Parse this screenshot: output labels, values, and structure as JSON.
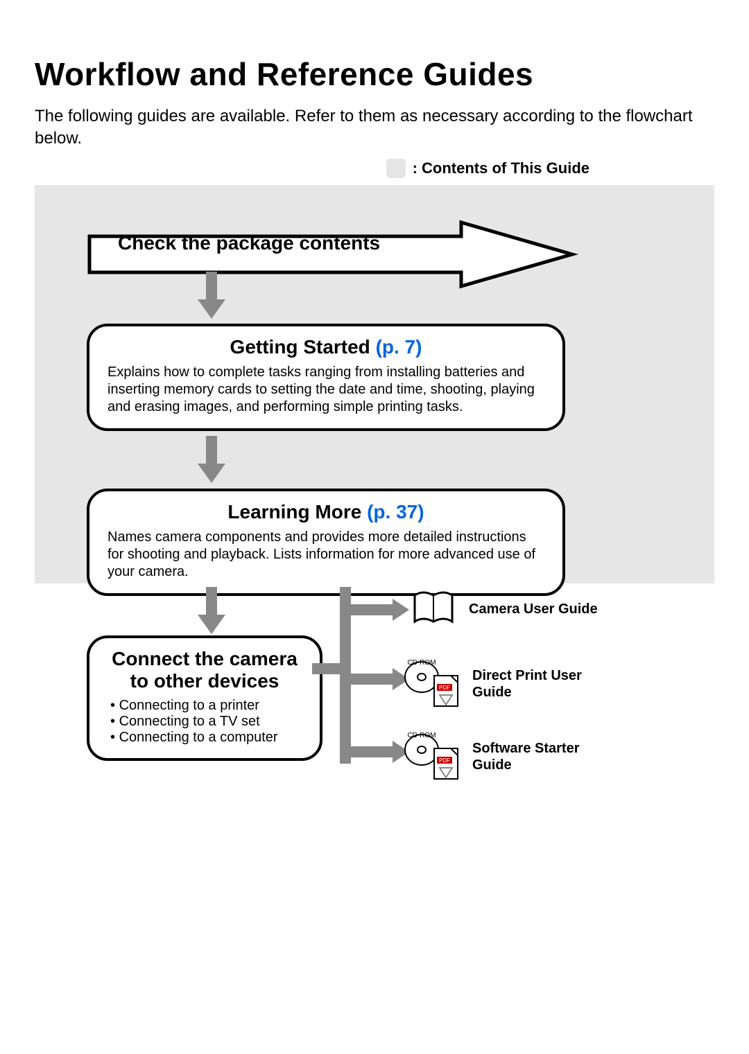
{
  "title": "Workflow and Reference Guides",
  "intro": "The following guides are available. Refer to them as necessary according to the flowchart below.",
  "legend": ": Contents of This Guide",
  "step1": "Check the package contents",
  "box_getting_started": {
    "title": "Getting Started ",
    "pref": "(p. 7)",
    "body": "Explains how to complete tasks ranging from installing batteries and inserting memory cards to setting the date and time, shooting, playing and erasing images, and performing simple printing tasks."
  },
  "box_learning_more": {
    "title": "Learning More ",
    "pref": "(p. 37)",
    "body": "Names camera components and provides more detailed instructions for shooting and playback. Lists information for more advanced use of your camera."
  },
  "box_connect": {
    "title": "Connect the camera to other devices",
    "items": [
      "Connecting to a printer",
      "Connecting to a TV set",
      "Connecting to a computer"
    ]
  },
  "guides": {
    "camera": "Camera User Guide",
    "direct_print": "Direct Print User Guide",
    "software": "Software Starter Guide"
  },
  "cdrom_label": "CD-ROM",
  "pdf_label": "PDF"
}
